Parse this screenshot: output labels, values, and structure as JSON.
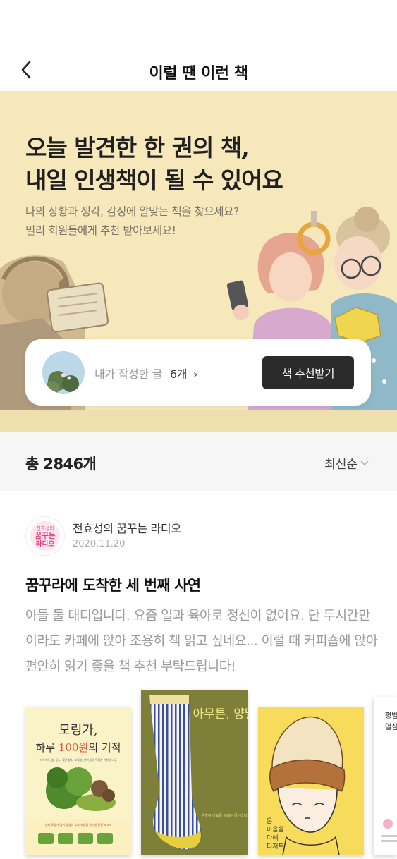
{
  "header": {
    "title": "이럴 땐 이런 책"
  },
  "hero": {
    "title_line1": "오늘 발견한 한 권의 책,",
    "title_line2": "내일 인생책이 될 수 있어요",
    "subtitle_line1": "나의 상황과 생각, 감정에 알맞는 책을 찾으세요?",
    "subtitle_line2": "밀리 회원들에게 추천 받아보세요!",
    "background_color": "#f6e8bb"
  },
  "profile_card": {
    "my_posts_label": "내가 작성한 글",
    "my_posts_count": "6개",
    "recommend_button": "책 추천받기"
  },
  "list": {
    "total": "총 2846개",
    "sort_label": "최신순"
  },
  "post": {
    "channel_name": "전효성의 꿈꾸는 라디오",
    "date": "2020.11.20",
    "title": "꿈꾸라에 도착한 세 번째 사연",
    "body": "아들 둘 대디입니다. 요즘 일과 육아로 정신이 없어요. 단 두시간만 이라도 카페에 앉아 조용히 책 읽고 싶네요... 이럴 때 커피숍에 앉아 편안히 읽기 좋을 책 추천 부탁드립니다!",
    "logo_text_top": "전효성의",
    "logo_text_mid": "꿈꾸는",
    "logo_text_bottom": "라디오"
  },
  "books": [
    {
      "title_line1": "모링가,",
      "title_line2_prefix": "하루 ",
      "title_line2_accent": "100원",
      "title_line2_suffix": "의 기적",
      "caption": "다이어트, 암, 당뇨, 혈관 청소, 고혈압, 변비 등에 탁월한 기적의 나무",
      "footer": "실제 모링가 섭취 경험과 효과 체험을 정리한 건강 보고서"
    },
    {
      "title": "아무튼, 양말",
      "tagline": "양말이 이토록 설레는 일이라니"
    },
    {
      "title_line1": "온",
      "title_line2": "마음을",
      "title_line3": "다해",
      "title_line4": "디저트"
    },
    {
      "title_line1": "평범",
      "title_line2": "열심"
    }
  ]
}
